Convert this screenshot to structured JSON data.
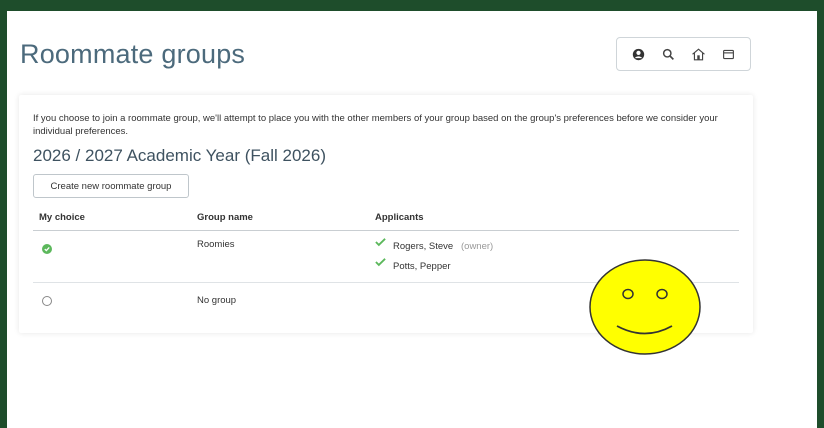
{
  "page": {
    "title": "Roommate groups"
  },
  "toolbar": {
    "icons": [
      "user-icon",
      "search-icon",
      "home-icon",
      "window-icon"
    ]
  },
  "card": {
    "intro": "If you choose to join a roommate group, we'll attempt to place you with the other members of your group based on the group's preferences before we consider your individual preferences.",
    "year_heading": "2026 / 2027 Academic Year (Fall 2026)",
    "create_button": "Create new roommate group"
  },
  "table": {
    "headers": {
      "choice": "My choice",
      "group": "Group name",
      "applicants": "Applicants"
    },
    "rows": [
      {
        "selected": true,
        "group": "Roomies",
        "applicants": [
          {
            "name": "Rogers, Steve",
            "note": "(owner)"
          },
          {
            "name": "Potts, Pepper",
            "note": ""
          }
        ]
      },
      {
        "selected": false,
        "group": "No group",
        "applicants": []
      }
    ]
  },
  "colors": {
    "frame": "#1e4d2b",
    "title": "#4c6a7c",
    "check": "#5cb85c",
    "smiley": "#ffff00"
  }
}
